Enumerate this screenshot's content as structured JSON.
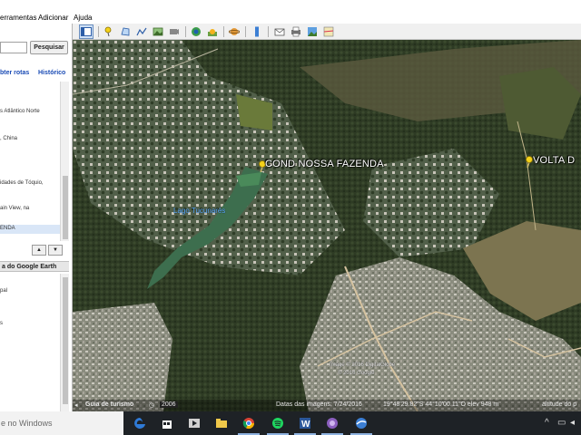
{
  "menu": {
    "items": [
      "erramentas",
      "Adicionar",
      "Ajuda"
    ]
  },
  "toolbar": {
    "buttons": [
      "sidebar-toggle",
      "placemark",
      "polygon",
      "path",
      "overlay",
      "record-tour",
      "history",
      "sun",
      "planets",
      "ruler",
      "email",
      "print",
      "save-image",
      "view-in-maps"
    ]
  },
  "sidebar": {
    "search_button": "Pesquisar",
    "directions_link": "bter rotas",
    "history_link": "Histórico",
    "results": [
      "s Atlântico Norte",
      ", China",
      "idades de Tóquio,",
      "ain View, na",
      "ENDA"
    ],
    "places_header": "a do Google Earth",
    "places": [
      "pal",
      "s"
    ]
  },
  "map": {
    "place_label_1": "COND NOSSA FAZENDA",
    "place_label_2": "VOLTA D",
    "lake_label": "Lago Tucunarés",
    "copyright_1": "Image © 2016 DigitalGlobe",
    "copyright_2": "© 2016 Google"
  },
  "status": {
    "tour_guide": "Guia de turismo",
    "year": "2006",
    "imagery_date": "Datas das imagens: 7/24/2016",
    "coords": "19°48'29.82\"S  44°10'00.11\"O  elev  948 m",
    "altitude": "altitude do p"
  },
  "taskbar": {
    "search_placeholder": "e no Windows",
    "apps": [
      "edge",
      "store",
      "media",
      "explorer",
      "chrome",
      "spotify",
      "word",
      "app-purple",
      "google-earth"
    ]
  },
  "colors": {
    "accent": "#3c7fd4",
    "link": "#1a4bb5",
    "pin": "#f4d21a"
  }
}
